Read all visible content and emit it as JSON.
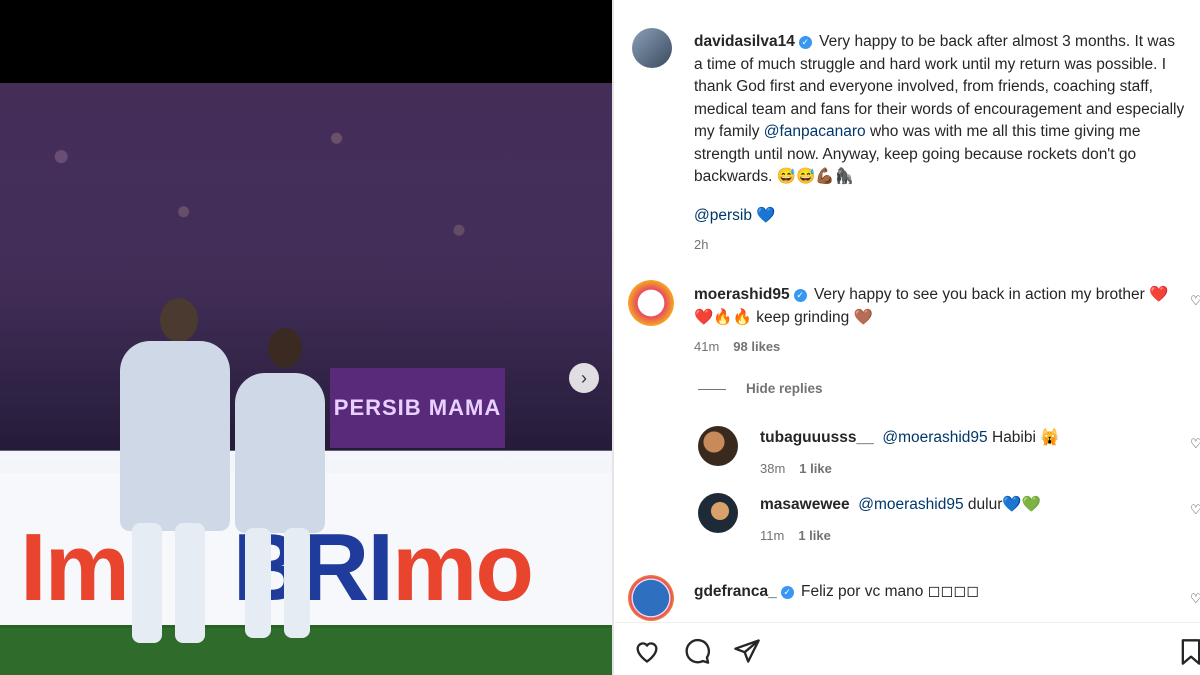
{
  "post": {
    "author": "davidasilva14",
    "caption_before": "Very happy to be back after almost 3 months. It was a time of much struggle and hard work until my return was possible. I thank God first and everyone involved, from friends, coaching staff, medical team and fans for their words of encouragement and especially my family ",
    "caption_mention": "@fanpacanaro",
    "caption_after": " who was with me all this time giving me strength until now. Anyway, keep going because rockets don't go backwards. 😅😅💪🏾🦍",
    "tag": "@persib",
    "tag_emoji": "💙",
    "time": "2h"
  },
  "photo": {
    "banner_text": "PERSIB MAMA",
    "board_text_1": "BRI",
    "board_text_2": "mo"
  },
  "comments": [
    {
      "user": "moerashid95",
      "verified": true,
      "text": "Very happy to see you back in action my brother ❤️❤️🔥🔥 keep grinding 🤎",
      "time": "41m",
      "likes": "98 likes"
    },
    {
      "user": "gdefranca_",
      "verified": true,
      "text": "Feliz por vc mano ◻◻◻◻",
      "time": "",
      "likes": ""
    }
  ],
  "hide_replies": "Hide replies",
  "replies": [
    {
      "user": "tubaguuusss__",
      "mention": "@moerashid95",
      "text": " Habibi 🙀",
      "time": "38m",
      "likes": "1 like"
    },
    {
      "user": "masawewee",
      "mention": "@moerashid95",
      "text": " dulur💙💚",
      "time": "11m",
      "likes": "1 like"
    }
  ],
  "icons": {
    "like": "heart-icon",
    "comment": "comment-icon",
    "share": "share-icon",
    "save": "bookmark-icon",
    "next": "chevron-right-icon"
  },
  "colors": {
    "mention": "#00376b",
    "verified": "#3897f0"
  }
}
